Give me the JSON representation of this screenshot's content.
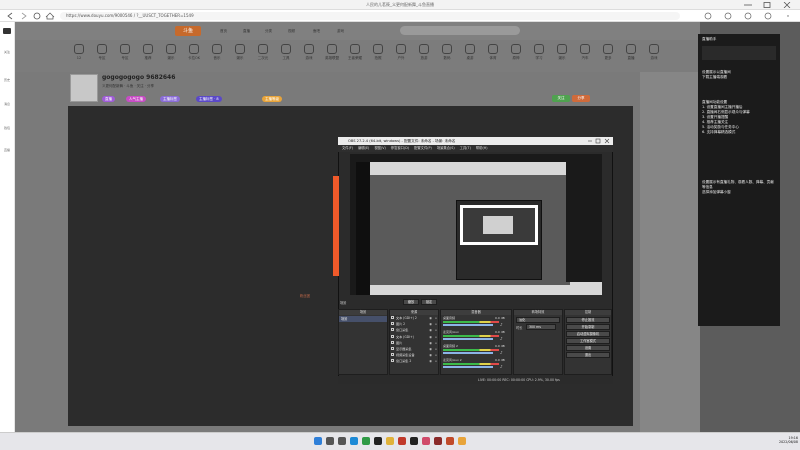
{
  "browser": {
    "title": "人民的儿茗筱_义更何配新舞_斗鱼直播",
    "url": "https://www.douyu.com/9000546 / ?__UUSCT_TOGETHER=1549",
    "tabs_icons": [
      "back-icon",
      "forward-icon",
      "reload-icon",
      "home-icon"
    ]
  },
  "site": {
    "logo": "斗鱼",
    "nav": [
      "首页",
      "直播",
      "分类",
      "视频",
      "鱼吧",
      "游戏",
      "活动"
    ],
    "categories": [
      "12",
      "专区",
      "专区",
      "推荐",
      "娱乐",
      "卡拉OK",
      "音乐",
      "娱乐",
      "二次元",
      "工具",
      "游戏",
      "英雄联盟",
      "王者荣耀",
      "拍照",
      "户外",
      "旅游",
      "数码",
      "桌游",
      "体育",
      "原神",
      "学习",
      "娱乐",
      "汽车",
      "更多",
      "直播",
      "游戏"
    ],
    "leftbar_items": [
      "关注",
      "历史",
      "消息",
      "钱包",
      "直播"
    ]
  },
  "streamer": {
    "name": "gogogogogo 9682646",
    "subtitle": "义更何配新舞 · 斗鱼 · 关注 · 分享",
    "tags": [
      "直播",
      "人气主播",
      "主播标签",
      "主播标签 · 8",
      "主播等级"
    ],
    "tag_colors": [
      "#a05cd8",
      "#c84cc6",
      "#8a6cd8",
      "#5a48c8",
      "#e8a43a"
    ],
    "follow_label": "关注",
    "share_label": "分享"
  },
  "right_panel": {
    "header": "直播助手",
    "lines_a": [
      "设置展示以直播间",
      "下载主播端观看"
    ],
    "lines_b": [
      "直播间功能设置",
      "1. 设置直播间主播开播后",
      "2. 直播间右侧显示观众与弹幕",
      "3. 设置开播提醒",
      "4. 推荐主播关注",
      "5. 活动奖励与任务中心",
      "6. 支持弹幕精选模式"
    ],
    "lines_c": [
      "设置展示有直播礼物、观看人数、弹幕、贡献等信息",
      "选择添加弹幕小窗"
    ]
  },
  "obs": {
    "title": "OBS 27.2.4 (64-bit, windows) - 配置文件: 未命名 - 场景: 未命名",
    "menu": [
      "文件(F)",
      "编辑(E)",
      "视图(V)",
      "停靠窗口(D)",
      "配置文件(P)",
      "场景集合(S)",
      "工具(T)",
      "帮助(H)"
    ],
    "scene_header": "场景",
    "source_header": "来源",
    "mixer_header": "混音器",
    "trans_header": "转场特效",
    "control_header": "控制",
    "scene_items": [
      "场景"
    ],
    "sources": [
      "文本 (GDI+) 2",
      "图片 2",
      "窗口采集",
      "文本 (GDI+)",
      "图片",
      "显示器采集",
      "视频采集设备",
      "窗口采集 2"
    ],
    "mixer_channels": [
      {
        "name": "桌面音频",
        "level": "0.0 dB"
      },
      {
        "name": "麦克风/Aux",
        "level": "0.0 dB"
      },
      {
        "name": "桌面音频 2",
        "level": "0.0 dB"
      },
      {
        "name": "麦克风/Aux 2",
        "level": "0.0 dB"
      }
    ],
    "transition": {
      "type": "淡化",
      "duration_label": "时长",
      "duration": "300 ms"
    },
    "controls": [
      "停止推流",
      "开始录制",
      "启动虚拟摄像机",
      "工作室模式",
      "设置",
      "退出"
    ],
    "preview_buttons": [
      "缩放",
      "锁定"
    ],
    "status": "LIVE: 00:00:00   REC: 00:00:00   CPU: 2.9%, 30.00 fps",
    "label_overlay": "粉丝团"
  },
  "taskbar": {
    "time": "19:16",
    "date": "2022/06/08",
    "icons": [
      "windows-icon",
      "search-icon",
      "taskview-icon",
      "edge-icon",
      "chrome-icon",
      "obs-icon",
      "explorer-icon",
      "app-icon",
      "app-icon",
      "app-icon",
      "app-icon",
      "app-icon",
      "folder-icon"
    ]
  }
}
